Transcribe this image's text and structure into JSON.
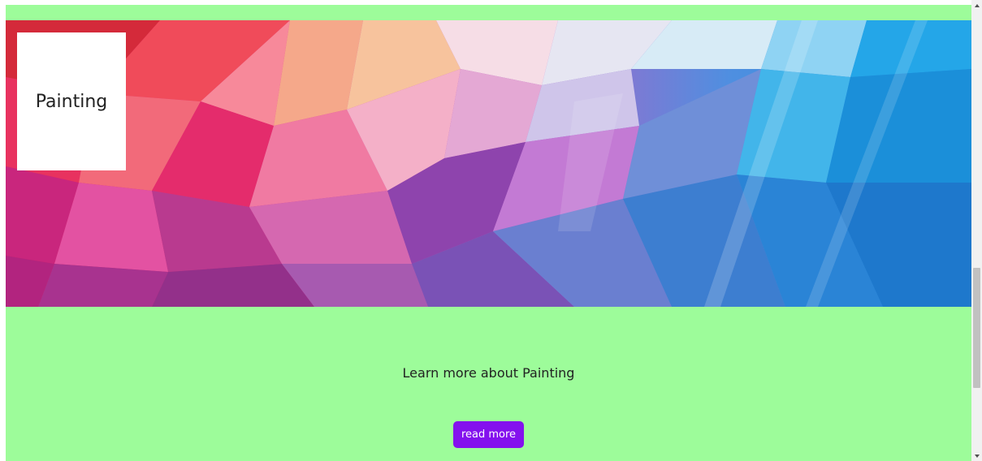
{
  "banner": {
    "card_title": "Painting",
    "image_name": "colorful-low-poly-geometric-background"
  },
  "section": {
    "learn_text": "Learn more about Painting",
    "button_label": "read more"
  },
  "colors": {
    "section_background": "#9dfc9a",
    "button": "#8411ee",
    "card_background": "#ffffff"
  },
  "scrollbar": {
    "up_icon": "chevron-up-icon",
    "down_icon": "chevron-down-icon"
  }
}
